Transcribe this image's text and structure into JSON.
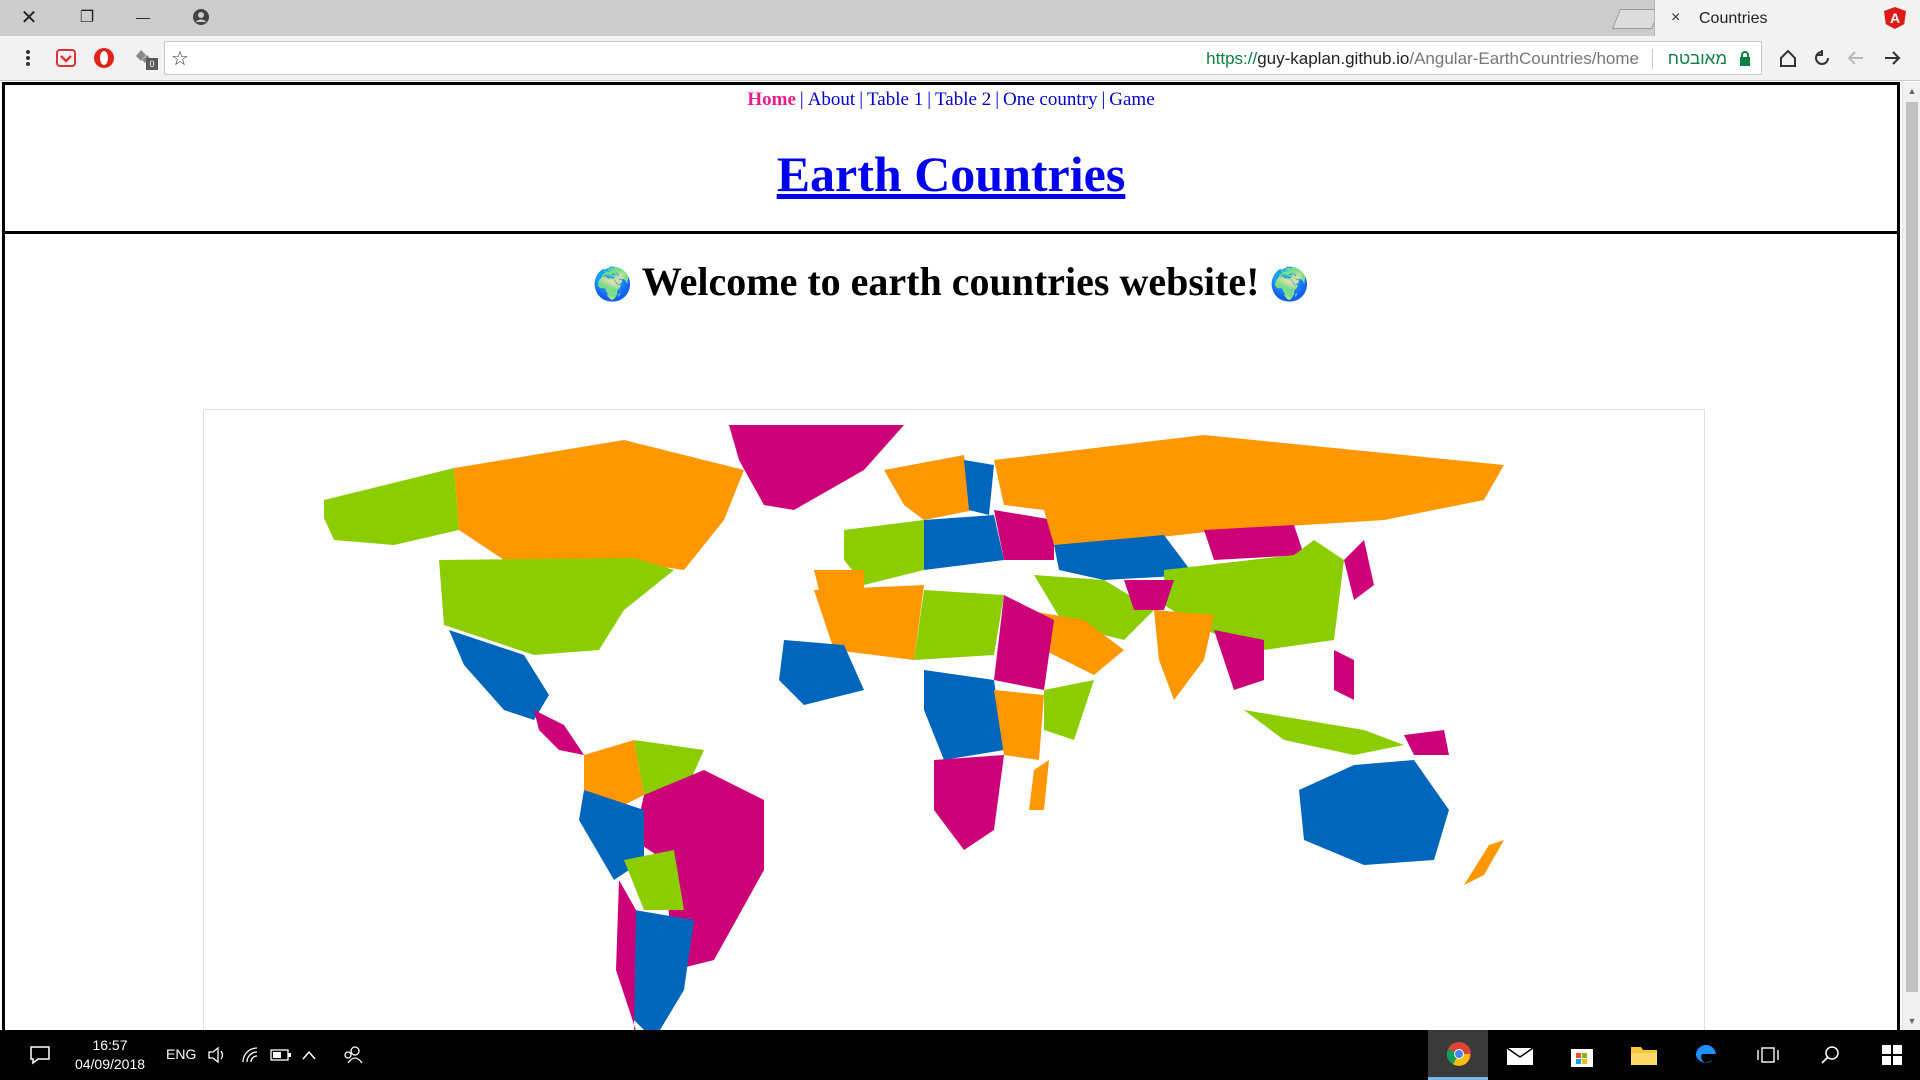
{
  "browser": {
    "tab": {
      "title": "Countries",
      "close_glyph": "×",
      "favicon": "A"
    },
    "window_controls": {
      "close": "✕",
      "restore": "❐",
      "minimize": "—",
      "profile": "●"
    },
    "address": {
      "scheme": "https://",
      "host": "guy-kaplan.github.io",
      "path": "/Angular-EarthCountries/home",
      "secure_label": "מאובטח"
    },
    "toolbar_icons": [
      "menu-icon",
      "pocket-icon",
      "opera-icon",
      "extension-icon",
      "star-icon",
      "home-icon",
      "reload-icon",
      "back-icon",
      "forward-icon"
    ],
    "extension_badge": "0"
  },
  "page": {
    "nav": [
      {
        "label": "Home",
        "active": true
      },
      {
        "label": "About",
        "active": false
      },
      {
        "label": "Table 1",
        "active": false
      },
      {
        "label": "Table 2",
        "active": false
      },
      {
        "label": "One country",
        "active": false
      },
      {
        "label": "Game",
        "active": false
      }
    ],
    "nav_separator": "|",
    "site_title": "Earth Countries",
    "welcome": "Welcome to earth countries website!",
    "globe_glyph": "🌍",
    "map_colors": [
      "#ff9800",
      "#8bcd00",
      "#0066bb",
      "#cc0077"
    ]
  },
  "taskbar": {
    "time": "16:57",
    "date": "04/09/2018",
    "language": "ENG"
  },
  "colors": {
    "nav_link": "#0000cc",
    "nav_active": "#e91e8c",
    "secure_green": "#0b8043"
  }
}
